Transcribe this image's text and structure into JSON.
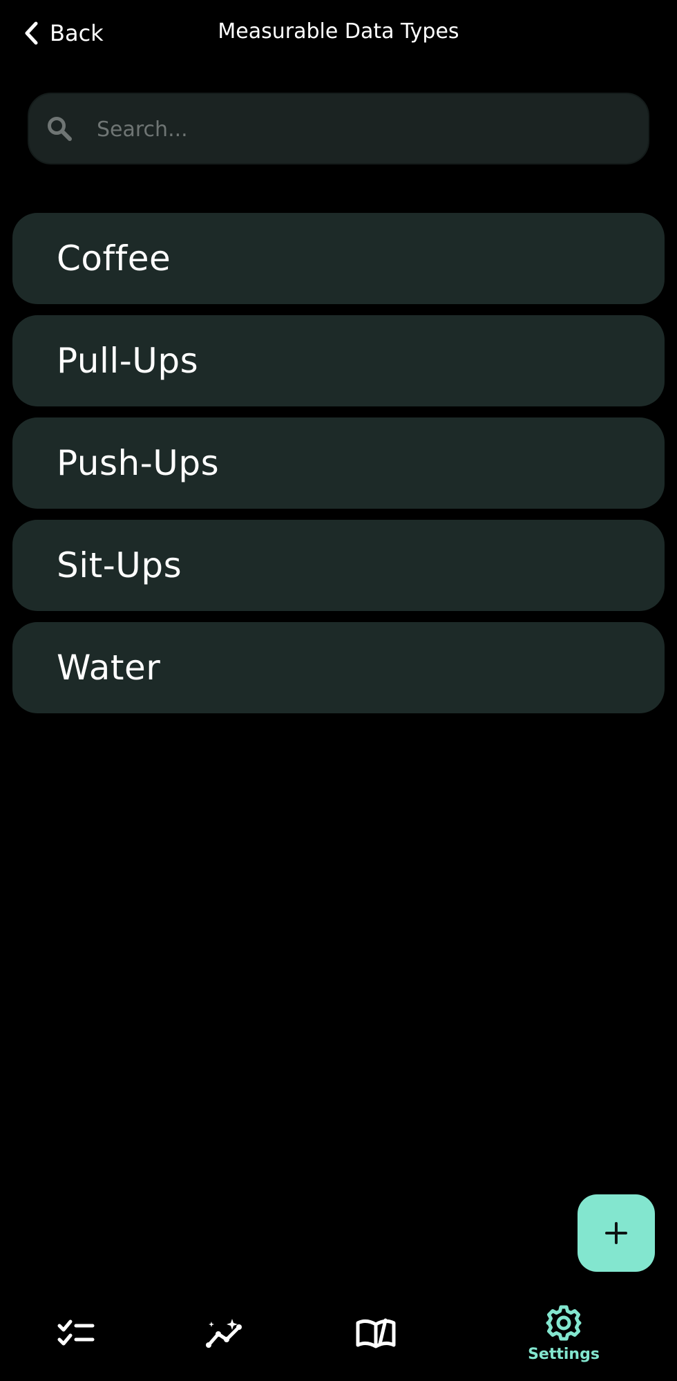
{
  "header": {
    "back_label": "Back",
    "title": "Measurable Data Types"
  },
  "search": {
    "placeholder": "Search...",
    "value": ""
  },
  "items": [
    {
      "label": "Coffee"
    },
    {
      "label": "Pull-Ups"
    },
    {
      "label": "Push-Ups"
    },
    {
      "label": "Sit-Ups"
    },
    {
      "label": "Water"
    }
  ],
  "fab": {
    "icon": "plus-icon"
  },
  "nav": {
    "tasks": {
      "icon": "checklist-icon"
    },
    "insights": {
      "icon": "sparkle-trend-icon"
    },
    "journal": {
      "icon": "book-open-icon"
    },
    "settings": {
      "icon": "gear-icon",
      "label": "Settings",
      "active": true
    }
  },
  "colors": {
    "accent": "#83e6cf",
    "card": "#1d2a28",
    "search_bg": "#1b2322",
    "background": "#000000"
  }
}
